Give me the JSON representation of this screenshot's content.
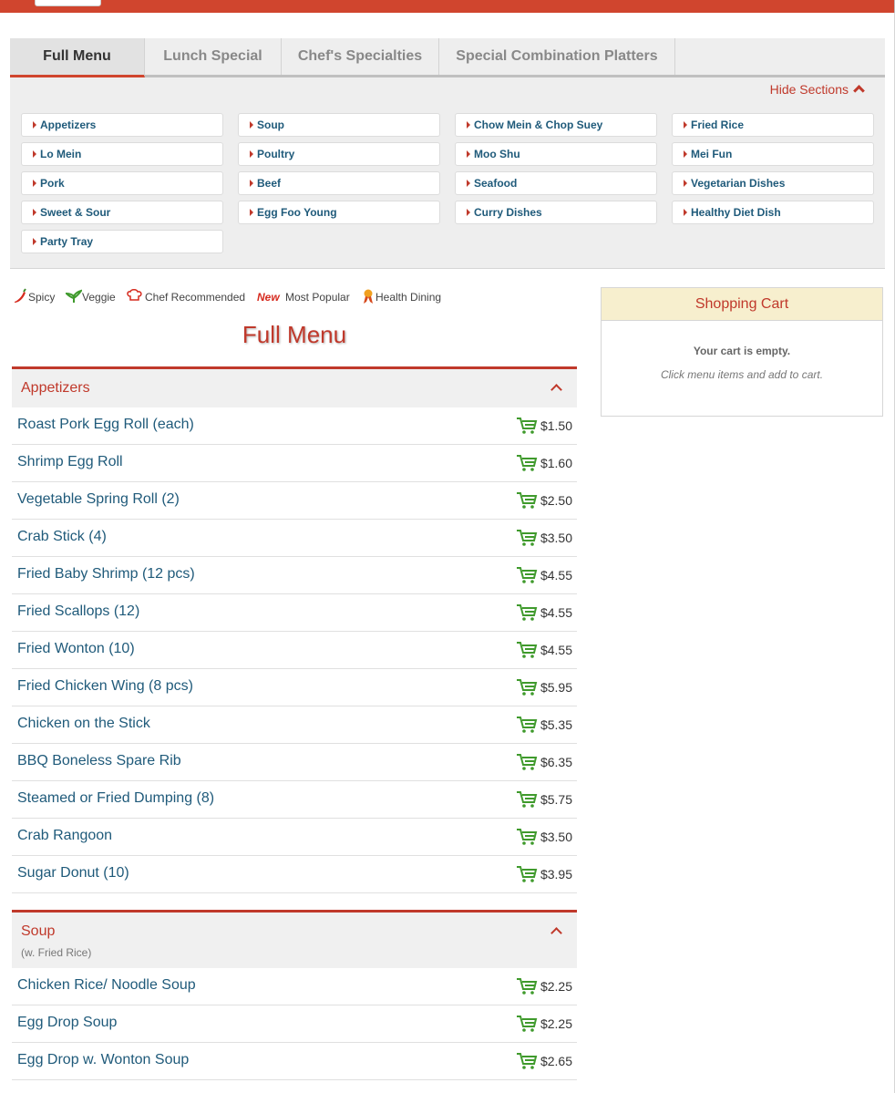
{
  "tabs": [
    {
      "label": "Full Menu",
      "active": true
    },
    {
      "label": "Lunch Special",
      "active": false
    },
    {
      "label": "Chef's Specialties",
      "active": false
    },
    {
      "label": "Special Combination Platters",
      "active": false
    }
  ],
  "hide_sections_label": "Hide Sections",
  "section_links": [
    "Appetizers",
    "Soup",
    "Chow Mein & Chop Suey",
    "Fried Rice",
    "Lo Mein",
    "Poultry",
    "Moo Shu",
    "Mei Fun",
    "Pork",
    "Beef",
    "Seafood",
    "Vegetarian Dishes",
    "Sweet & Sour",
    "Egg Foo Young",
    "Curry Dishes",
    "Healthy Diet Dish",
    "Party Tray"
  ],
  "legend": [
    {
      "icon": "chili-pepper-icon",
      "label": "Spicy"
    },
    {
      "icon": "leaf-icon",
      "label": "Veggie"
    },
    {
      "icon": "chef-hat-icon",
      "label": "Chef Recommended"
    },
    {
      "icon": "new-badge-icon",
      "label": "Most Popular"
    },
    {
      "icon": "ribbon-icon",
      "label": "Health Dining"
    }
  ],
  "page_title": "Full Menu",
  "sections": [
    {
      "title": "Appetizers",
      "subtitle": "",
      "items": [
        {
          "name": "Roast Pork Egg Roll (each)",
          "price": "$1.50"
        },
        {
          "name": "Shrimp Egg Roll",
          "price": "$1.60"
        },
        {
          "name": "Vegetable Spring Roll (2)",
          "price": "$2.50"
        },
        {
          "name": "Crab Stick (4)",
          "price": "$3.50"
        },
        {
          "name": "Fried Baby Shrimp (12 pcs)",
          "price": "$4.55"
        },
        {
          "name": "Fried Scallops (12)",
          "price": "$4.55"
        },
        {
          "name": "Fried Wonton (10)",
          "price": "$4.55"
        },
        {
          "name": "Fried Chicken Wing (8 pcs)",
          "price": "$5.95"
        },
        {
          "name": "Chicken on the Stick",
          "price": "$5.35"
        },
        {
          "name": "BBQ Boneless Spare Rib",
          "price": "$6.35"
        },
        {
          "name": "Steamed or Fried Dumping (8)",
          "price": "$5.75"
        },
        {
          "name": "Crab Rangoon",
          "price": "$3.50"
        },
        {
          "name": "Sugar Donut (10)",
          "price": "$3.95"
        }
      ]
    },
    {
      "title": "Soup",
      "subtitle": "(w. Fried Rice)",
      "items": [
        {
          "name": "Chicken Rice/ Noodle Soup",
          "price": "$2.25"
        },
        {
          "name": "Egg Drop Soup",
          "price": "$2.25"
        },
        {
          "name": "Egg Drop w. Wonton Soup",
          "price": "$2.65"
        }
      ]
    }
  ],
  "cart": {
    "title": "Shopping Cart",
    "empty_text": "Your cart is empty.",
    "hint": "Click menu items and add to cart."
  },
  "colors": {
    "brand_red": "#d0452e",
    "link_blue": "#1f5a7a",
    "cart_green": "#3f9a2c",
    "cart_header_bg": "#f7efce"
  }
}
